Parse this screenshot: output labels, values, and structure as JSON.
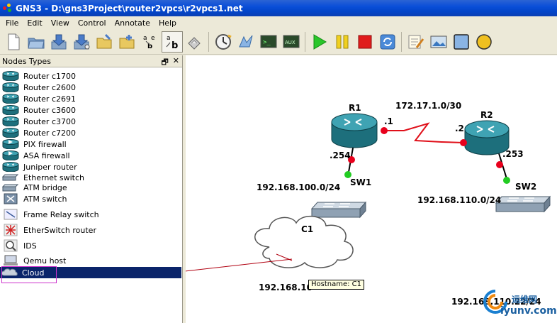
{
  "window": {
    "title": "GNS3 - D:\\gns3Project\\router2vpcs\\r2vpcs1.net"
  },
  "menu": [
    "File",
    "Edit",
    "View",
    "Control",
    "Annotate",
    "Help"
  ],
  "toolbar_icons": [
    "new-file-icon",
    "open-folder-icon",
    "save-icon",
    "save-as-icon",
    "open-project-icon",
    "save-project-icon",
    "show-interface-labels-icon",
    "show-hostnames-icon",
    "add-link-icon",
    "dynamips-idle-pc-icon",
    "console-icon",
    "console-all-icon",
    "aux-console-icon",
    "start-all-icon",
    "suspend-all-icon",
    "stop-all-icon",
    "reload-all-icon",
    "add-note-icon",
    "insert-picture-icon",
    "draw-rectangle-icon",
    "draw-ellipse-icon"
  ],
  "panel": {
    "title": "Nodes Types",
    "items": [
      {
        "label": "Router c1700",
        "icon": "router-icon"
      },
      {
        "label": "Router c2600",
        "icon": "router-icon"
      },
      {
        "label": "Router c2691",
        "icon": "router-icon"
      },
      {
        "label": "Router c3600",
        "icon": "router-icon"
      },
      {
        "label": "Router c3700",
        "icon": "router-icon"
      },
      {
        "label": "Router c7200",
        "icon": "router-icon"
      },
      {
        "label": "PIX firewall",
        "icon": "firewall-icon"
      },
      {
        "label": "ASA firewall",
        "icon": "firewall-icon"
      },
      {
        "label": "Juniper router",
        "icon": "router-icon"
      },
      {
        "label": "Ethernet switch",
        "icon": "switch-icon"
      },
      {
        "label": "ATM bridge",
        "icon": "atm-bridge-icon"
      },
      {
        "label": "ATM switch",
        "icon": "atm-switch-icon"
      },
      {
        "label": "Frame Relay switch",
        "icon": "frame-relay-icon"
      },
      {
        "label": "EtherSwitch router",
        "icon": "etherswitch-icon"
      },
      {
        "label": "IDS",
        "icon": "ids-icon"
      },
      {
        "label": "Qemu host",
        "icon": "host-icon"
      },
      {
        "label": "Cloud",
        "icon": "cloud-icon",
        "selected": true
      }
    ]
  },
  "topology": {
    "r1": "R1",
    "r2": "R2",
    "sw1": "SW1",
    "sw2": "SW2",
    "c1": "C1",
    "wan_net": "172.17.1.0/30",
    "r1_wan_if": ".1",
    "r2_wan_if": ".2",
    "r1_lan_if": ".254",
    "r2_lan_if": ".253",
    "lan1": "192.168.100.0/24",
    "lan2": "192.168.110.0/24",
    "cloud_net_visible": "192.168.10",
    "bottom_net": "192.168.110.22/24",
    "tooltip": "Hostname: C1"
  },
  "watermark": {
    "cn": "运维网",
    "domain": "iyunv.com"
  },
  "colors": {
    "titlebar": "#0a4ed8",
    "selection": "#0a246a",
    "link": "#e0101a",
    "port_red": "#e8001c",
    "port_green": "#22cc22",
    "highlight_box": "#cc33cc"
  }
}
